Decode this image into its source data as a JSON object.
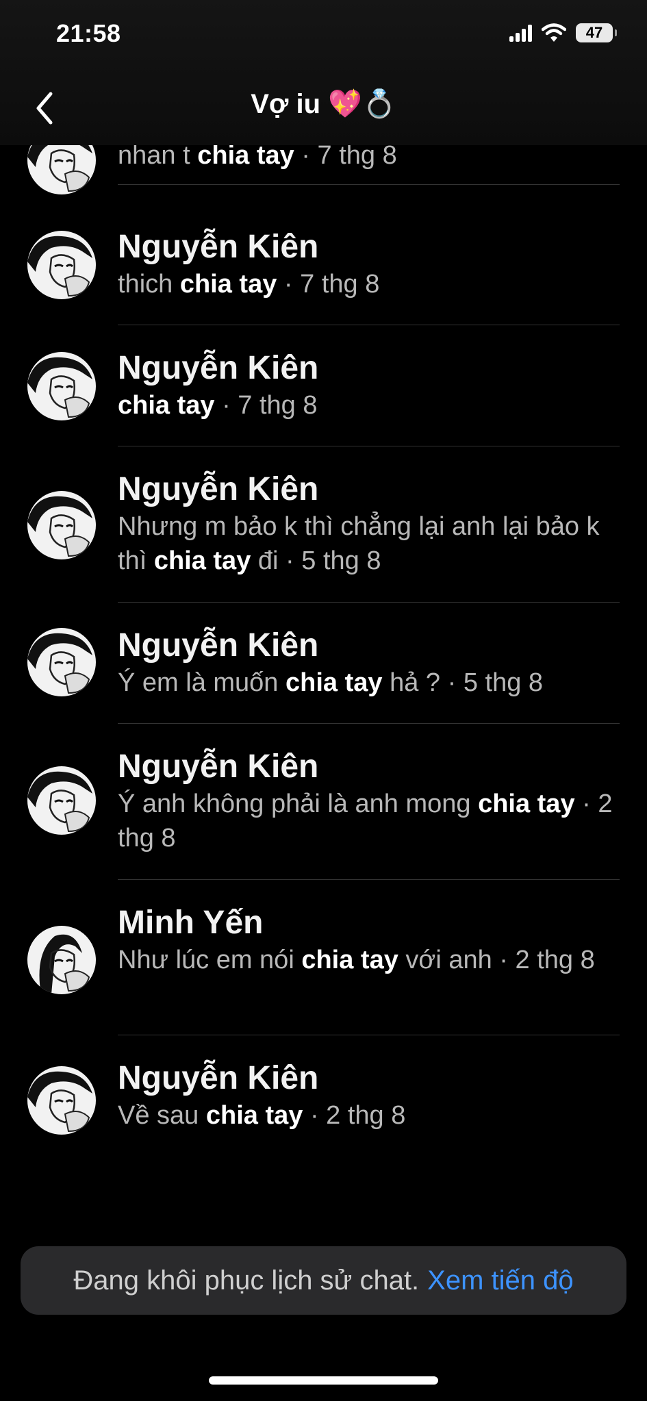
{
  "status_bar": {
    "time": "21:58",
    "battery": "47"
  },
  "header": {
    "title": "Vợ iu 💖💍"
  },
  "results": [
    {
      "name": "",
      "pre": "nhan t ",
      "hit": "chia tay",
      "post": "",
      "date": " · 7 thg 8"
    },
    {
      "name": "Nguyễn Kiên",
      "pre": "thich ",
      "hit": "chia tay",
      "post": "",
      "date": " · 7 thg 8"
    },
    {
      "name": "Nguyễn Kiên",
      "pre": "",
      "hit": "chia tay",
      "post": "",
      "date": " · 7 thg 8"
    },
    {
      "name": "Nguyễn Kiên",
      "pre": "Nhưng m bảo k thì chẳng lại anh lại bảo k thì ",
      "hit": "chia tay",
      "post": " đi",
      "date": " · 5 thg 8"
    },
    {
      "name": "Nguyễn Kiên",
      "pre": "Ý em là muốn ",
      "hit": "chia tay",
      "post": " hả ?",
      "date": " · 5 thg 8"
    },
    {
      "name": "Nguyễn Kiên",
      "pre": "Ý anh không phải là anh mong ",
      "hit": "chia tay",
      "post": "",
      "date": " · 2 thg 8"
    },
    {
      "name": "Minh Yến",
      "pre": "Như lúc em nói ",
      "hit": "chia tay",
      "post": " với anh",
      "date": " · 2 thg 8"
    },
    {
      "name": "Nguyễn Kiên",
      "pre": "Về sau ",
      "hit": "chia tay",
      "post": "",
      "date": " · 2 thg 8"
    }
  ],
  "toast": {
    "text": "Đang khôi phục lịch sử chat.",
    "link": "Xem tiến độ"
  },
  "colors": {
    "link": "#3d93ff",
    "background": "#000000"
  }
}
